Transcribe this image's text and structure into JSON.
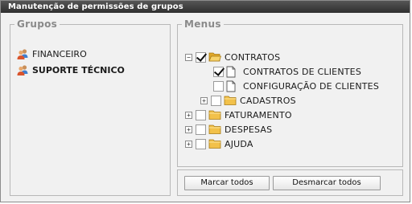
{
  "window": {
    "title": "Manutenção de permissões de grupos"
  },
  "groups": {
    "legend": "Grupos",
    "items": [
      {
        "label": "FINANCEIRO",
        "icon": "users-icon",
        "selected": false
      },
      {
        "label": "SUPORTE TÉCNICO",
        "icon": "users-icon",
        "selected": true
      }
    ]
  },
  "menus": {
    "legend": "Menus",
    "tree": [
      {
        "label": "CONTRATOS",
        "expander": "−",
        "checked": true,
        "icon": "folder-open-icon"
      },
      {
        "label": "CONTRATOS DE CLIENTES",
        "expander": "",
        "checked": true,
        "icon": "document-icon"
      },
      {
        "label": "CONFIGURAÇÃO DE CLIENTES",
        "expander": "",
        "checked": false,
        "icon": "document-icon"
      },
      {
        "label": "CADASTROS",
        "expander": "+",
        "checked": false,
        "icon": "folder-icon"
      },
      {
        "label": "FATURAMENTO",
        "expander": "+",
        "checked": false,
        "icon": "folder-icon"
      },
      {
        "label": "DESPESAS",
        "expander": "+",
        "checked": false,
        "icon": "folder-icon"
      },
      {
        "label": "AJUDA",
        "expander": "+",
        "checked": false,
        "icon": "folder-icon"
      }
    ]
  },
  "actions": {
    "mark_all": "Marcar todos",
    "unmark_all": "Desmarcar todos"
  },
  "colors": {
    "titlebar": "#3a3a3a",
    "folder": "#f2c14a",
    "legend": "#8a8a8a"
  }
}
